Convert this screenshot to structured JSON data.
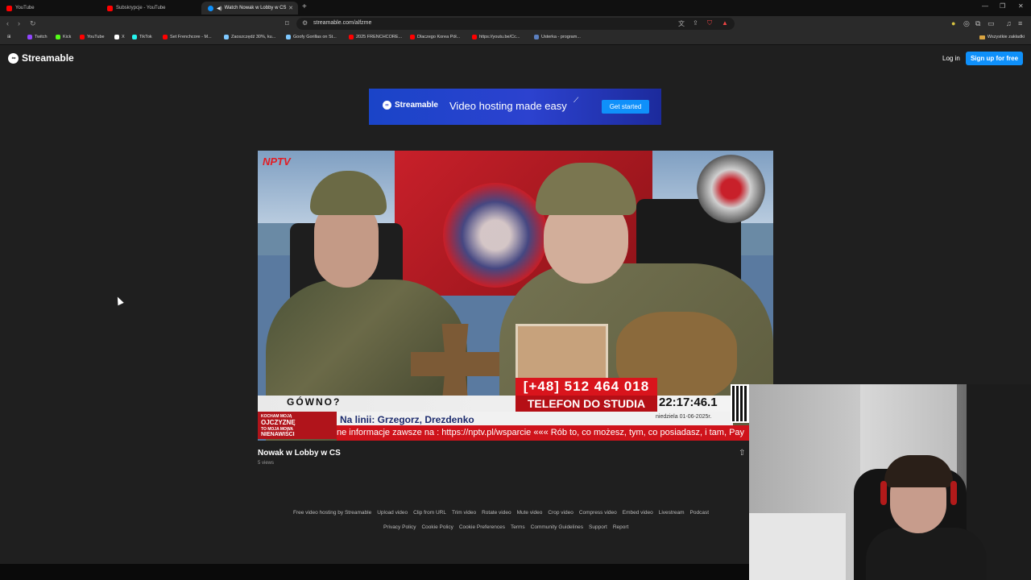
{
  "browser": {
    "tabs": [
      {
        "label": "YouTube",
        "color": "#ff0000"
      },
      {
        "label": "Subskrypcje - YouTube",
        "color": "#ff0000"
      },
      {
        "label": "Watch Nowak w Lobby w CS",
        "color": "#0f90fa"
      }
    ],
    "url": "streamable.com/alfzme",
    "bookmarks": [
      {
        "label": "Twitch",
        "color": "#9146ff"
      },
      {
        "label": "Kick",
        "color": "#53fc18"
      },
      {
        "label": "YouTube",
        "color": "#ff0000"
      },
      {
        "label": "X",
        "color": "#ffffff"
      },
      {
        "label": "TikTok",
        "color": "#25f4ee"
      },
      {
        "label": "Set Frenchcore - M...",
        "color": "#ff0000"
      },
      {
        "label": "Zaoszczędź 30%, ku...",
        "color": "#7ec8ff"
      },
      {
        "label": "Goofy Gorillas on St...",
        "color": "#7ec8ff"
      },
      {
        "label": "2025 FRENCHCORE...",
        "color": "#ff0000"
      },
      {
        "label": "Dlaczego Korea Pół...",
        "color": "#ff0000"
      },
      {
        "label": "https://youtu.be/Cc...",
        "color": "#ff0000"
      },
      {
        "label": "Usterka - program...",
        "color": "#5b7fbf"
      }
    ],
    "all_bookmarks": "Wszystkie zakładki"
  },
  "header": {
    "logo": "Streamable",
    "login": "Log in",
    "signup": "Sign up for free"
  },
  "banner": {
    "logo": "Streamable",
    "tagline": "Video hosting made easy",
    "cta": "Get started"
  },
  "video": {
    "channel_logo": "NPTV",
    "phone": "[+48]  512  464  018",
    "studio": "TELEFON DO STUDIA",
    "headline": "GÓWNO?",
    "clock": "22:17:46.1",
    "date": "niedziela 01-06-2025r.",
    "patriot_1": "KOCHAM MOJĄ",
    "patriot_2": "OJCZYZNĘ",
    "patriot_3": "TO MOJA MOWA",
    "patriot_4": "NIENAWIŚCI",
    "online": "Na linii: Grzegorz, Drezdenko",
    "ticker": "ne informacje zawsze na : https://nptv.pl/wsparcie   «««   Rób to, co możesz, tym, co posiadasz, i tam,   Pay",
    "title": "Nowak w Lobby w CS",
    "views": "5 views"
  },
  "footer": {
    "row1": [
      "Free video hosting by Streamable",
      "Upload video",
      "Clip from URL",
      "Trim video",
      "Rotate video",
      "Mute video",
      "Crop video",
      "Compress video",
      "Embed video",
      "Livestream",
      "Podcast"
    ],
    "row2": [
      "Privacy Policy",
      "Cookie Policy",
      "Cookie Preferences",
      "Terms",
      "Community Guidelines",
      "Support",
      "Report"
    ]
  }
}
